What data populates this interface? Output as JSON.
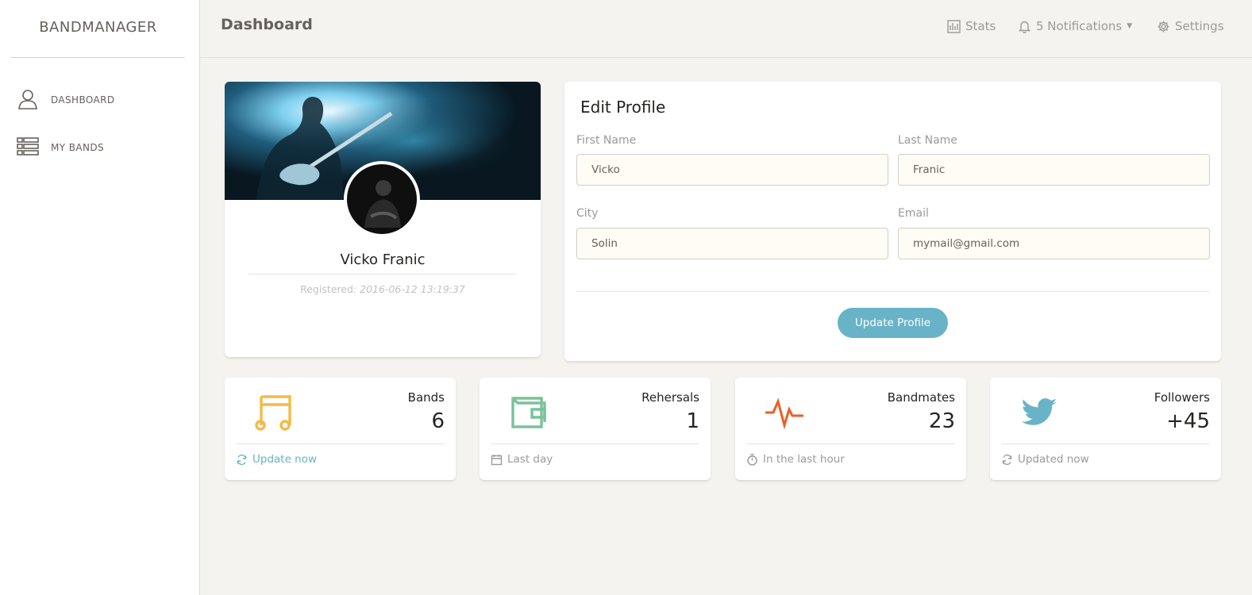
{
  "sidebar": {
    "brand": "BANDMANAGER",
    "items": [
      {
        "label": "DASHBOARD",
        "icon": "user-icon"
      },
      {
        "label": "MY BANDS",
        "icon": "list-icon"
      }
    ]
  },
  "topbar": {
    "title": "Dashboard",
    "stats_label": "Stats",
    "notifications_label": "5 Notifications",
    "settings_label": "Settings"
  },
  "profile": {
    "name": "Vicko Franic",
    "registered_label": "Registered:",
    "registered_date": "2016-06-12 13:19:37"
  },
  "edit_profile": {
    "title": "Edit Profile",
    "first_name_label": "First Name",
    "first_name_value": "Vicko",
    "last_name_label": "Last Name",
    "last_name_value": "Franic",
    "city_label": "City",
    "city_value": "Solin",
    "email_label": "Email",
    "email_value": "mymail@gmail.com",
    "submit_label": "Update Profile"
  },
  "stats": [
    {
      "label": "Bands",
      "value": "6",
      "footer": "Update now",
      "icon": "music-note-icon",
      "color": "#f3bb45"
    },
    {
      "label": "Rehersals",
      "value": "1",
      "footer": "Last day",
      "icon": "wallet-icon",
      "color": "#7ac29a"
    },
    {
      "label": "Bandmates",
      "value": "23",
      "footer": "In the last hour",
      "icon": "pulse-icon",
      "color": "#eb5e28"
    },
    {
      "label": "Followers",
      "value": "+45",
      "footer": "Updated now",
      "icon": "twitter-icon",
      "color": "#68b3c8"
    }
  ],
  "colors": {
    "accent": "#68b3c8",
    "background": "#f4f3ef",
    "input_background": "#fffcf5"
  }
}
